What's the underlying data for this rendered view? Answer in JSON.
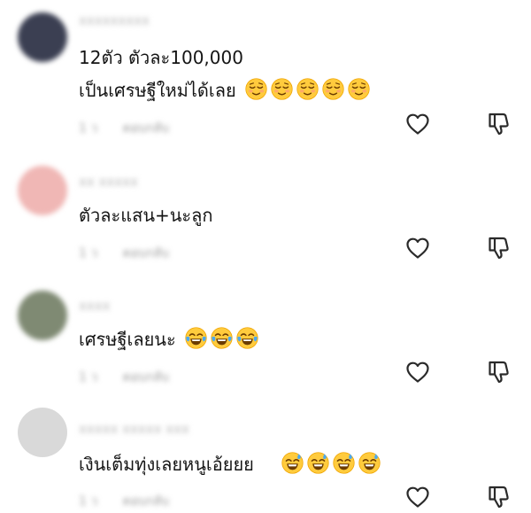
{
  "comments": [
    {
      "username": "xxxxxxxxx",
      "avatar_color": "#3b3f52",
      "lines": [
        "12ตัว ตัวละ100,000",
        "เป็นเศรษฐีใหม่ได้เลย"
      ],
      "emojis": [
        "relieved-face",
        "relieved-face",
        "relieved-face",
        "relieved-face",
        "relieved-face"
      ],
      "meta_time": "1 ว",
      "meta_reply": "ตอบกลับ",
      "like_icon": "heart-outline-icon",
      "dislike_icon": "thumbs-down-outline-icon"
    },
    {
      "username": "xx xxxxx",
      "avatar_color": "#f0b7b5",
      "lines": [
        "ตัวละแสน+นะลูก"
      ],
      "emojis": [],
      "meta_time": "1 ว",
      "meta_reply": "ตอบกลับ",
      "like_icon": "heart-outline-icon",
      "dislike_icon": "thumbs-down-outline-icon"
    },
    {
      "username": "xxxx",
      "avatar_color": "#7f8a73",
      "lines": [
        "เศรษฐีเลยนะ"
      ],
      "emojis": [
        "face-with-tears-of-joy",
        "face-with-tears-of-joy",
        "face-with-tears-of-joy"
      ],
      "meta_time": "1 ว",
      "meta_reply": "ตอบกลับ",
      "like_icon": "heart-outline-icon",
      "dislike_icon": "thumbs-down-outline-icon"
    },
    {
      "username": "xxxxx xxxxx xxx",
      "avatar_color": "#d9d9d9",
      "lines": [
        "เงินเต็มทุ่งเลยหนูเอ้ยยย"
      ],
      "emojis": [
        "grinning-face-with-sweat",
        "grinning-face-with-sweat",
        "grinning-face-with-sweat",
        "grinning-face-with-sweat"
      ],
      "meta_time": "1 ว",
      "meta_reply": "ตอบกลับ",
      "like_icon": "heart-outline-icon",
      "dislike_icon": "thumbs-down-outline-icon"
    }
  ]
}
